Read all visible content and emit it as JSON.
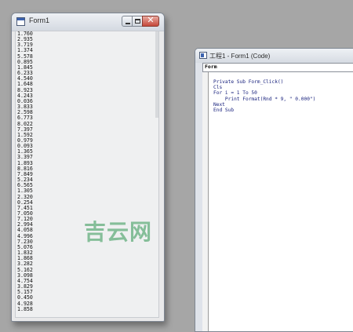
{
  "form1": {
    "title": "Form1",
    "icon": "form-icon",
    "window_buttons": {
      "minimize": "minimize-icon",
      "maximize": "maximize-icon",
      "close": "close-icon"
    },
    "close_glyph": "✕",
    "output_lines": [
      "1.760",
      "2.935",
      "3.719",
      "1.374",
      "5.578",
      "0.895",
      "1.845",
      "6.233",
      "4.540",
      "1.648",
      "8.923",
      "4.243",
      "0.036",
      "3.833",
      "2.598",
      "6.773",
      "8.022",
      "7.397",
      "1.592",
      "0.979",
      "0.093",
      "1.365",
      "3.397",
      "1.893",
      "8.816",
      "7.849",
      "5.234",
      "6.565",
      "1.305",
      "2.320",
      "0.254",
      "7.451",
      "7.050",
      "7.120",
      "2.994",
      "4.058",
      "4.996",
      "7.230",
      "5.076",
      "1.832",
      "1.868",
      "3.282",
      "5.162",
      "3.098",
      "4.754",
      "3.829",
      "5.157",
      "0.450",
      "4.928",
      "1.858"
    ]
  },
  "code_window": {
    "title": "工程1 - Form1 (Code)",
    "icon": "code-window-icon",
    "object_combo_value": "Form",
    "code_lines": [
      "Private Sub Form_Click()",
      "Cls",
      "For i = 1 To 50",
      "    Print Format(Rnd * 9, \" 0.000\")",
      "Next",
      "End Sub"
    ]
  },
  "watermark": "吉云网"
}
